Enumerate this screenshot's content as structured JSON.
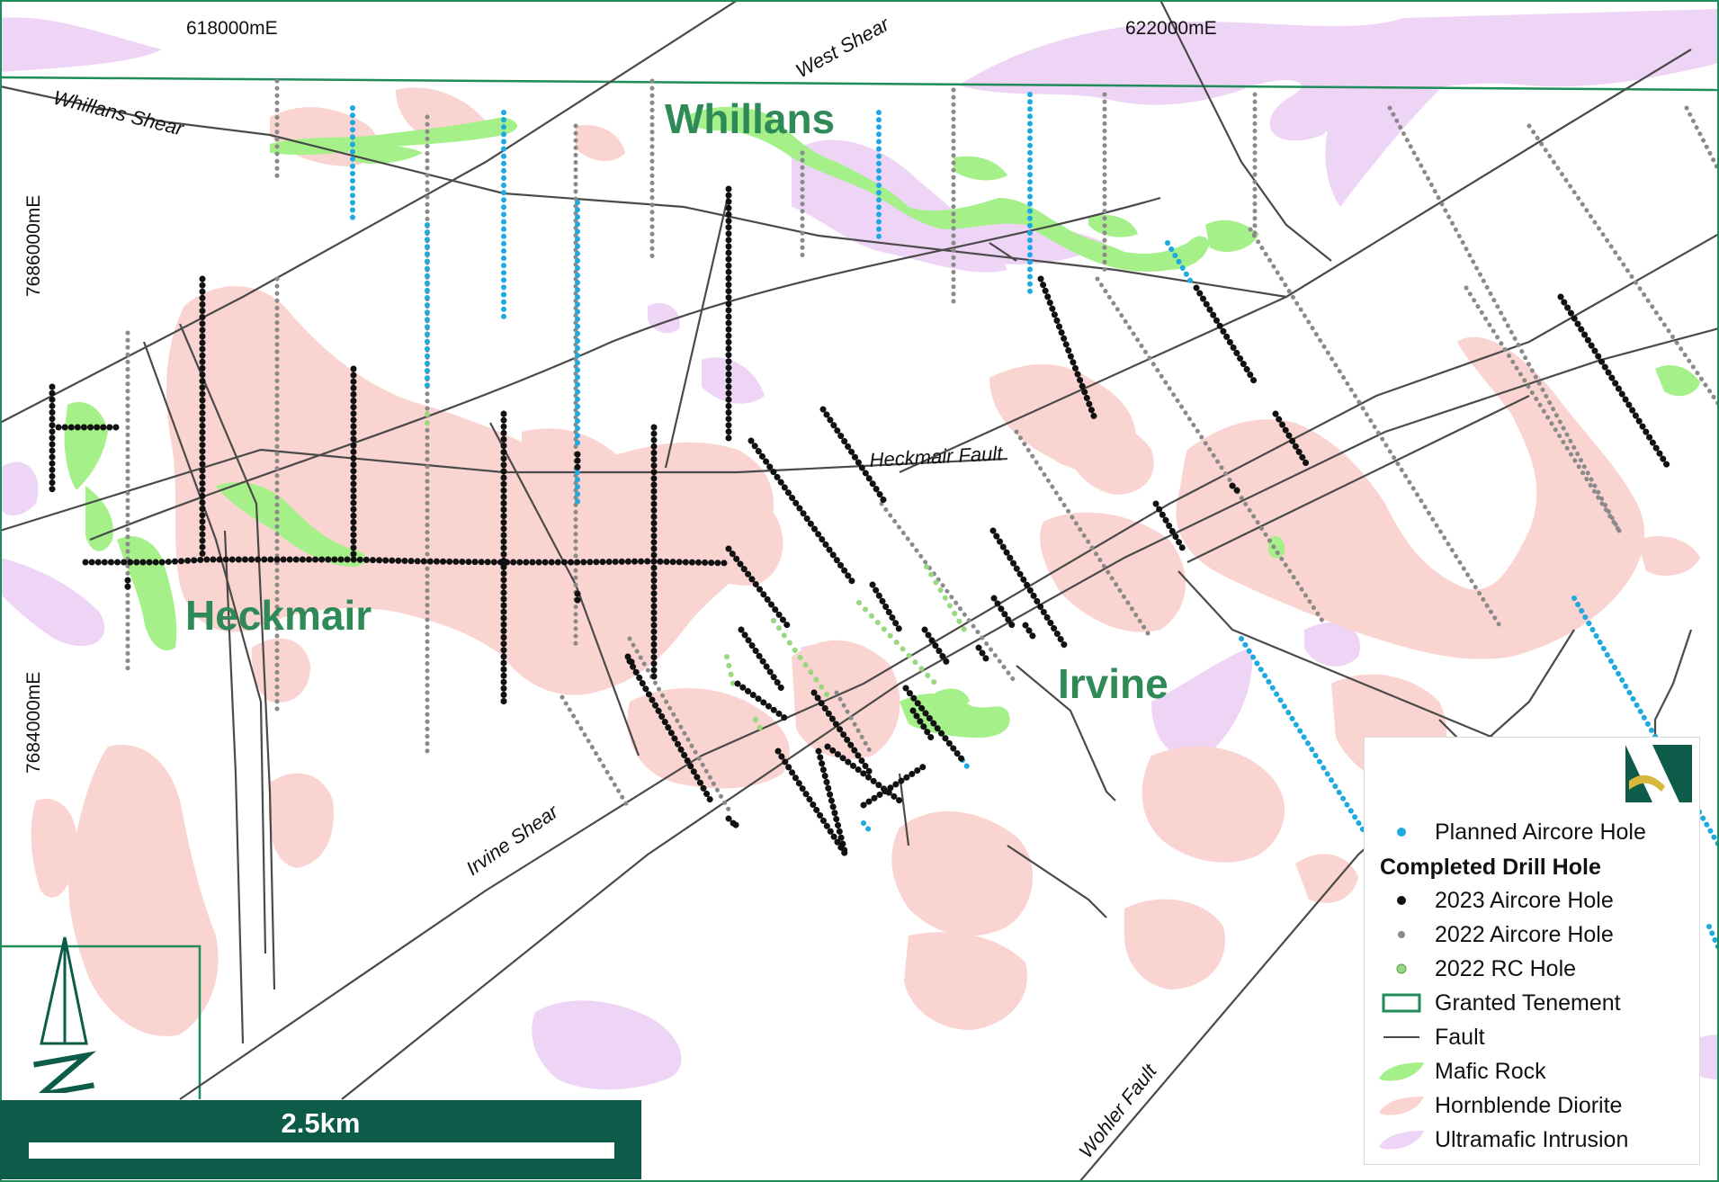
{
  "coords": {
    "easting_1": "618000mE",
    "easting_2": "622000mE",
    "northing_1": "7686000mE",
    "northing_2": "7684000mE"
  },
  "faults": {
    "whillans_shear": "Whillans Shear",
    "west_shear": "West Shear",
    "heckmair_fault": "Heckmair Fault",
    "irvine_shear": "Irvine Shear",
    "wohler_fault": "Wohler Fault"
  },
  "deposits": {
    "whillans": "Whillans",
    "heckmair": "Heckmair",
    "irvine": "Irvine"
  },
  "scale": {
    "label": "2.5km"
  },
  "north_arrow": {
    "letter": "N"
  },
  "legend": {
    "planned": "Planned Aircore Hole",
    "completed_heading": "Completed Drill Hole",
    "aircore_2023": "2023 Aircore Hole",
    "aircore_2022": "2022 Aircore Hole",
    "rc_2022": "2022 RC Hole",
    "tenement": "Granted Tenement",
    "fault": "Fault",
    "mafic": "Mafic Rock",
    "diorite": "Hornblende Diorite",
    "ultramafic": "Ultramafic Intrusion"
  },
  "colors": {
    "planned": "#1fa9e1",
    "aircore_2023": "#111111",
    "aircore_2022": "#8a8a8a",
    "rc_2022": "#98d880",
    "tenement": "#1f8c5a",
    "fault": "#4a4a4a",
    "mafic": "#a6f08a",
    "diorite": "#fad4d0",
    "ultramafic": "#eed4f5",
    "brand": "#0d5c4a"
  }
}
